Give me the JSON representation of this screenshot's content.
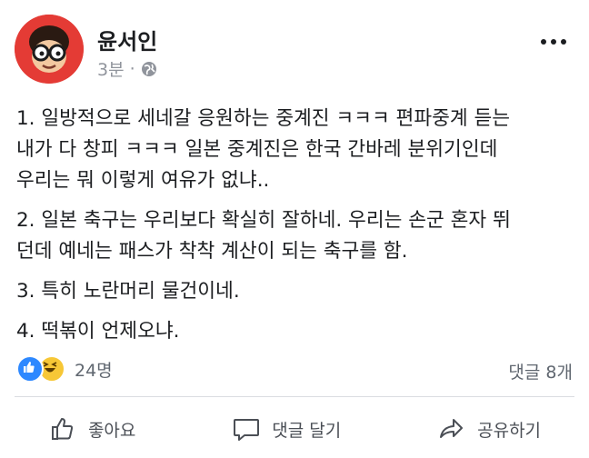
{
  "post": {
    "author": "윤서인",
    "time": "3분",
    "separator": "·",
    "privacy_icon": "globe-icon",
    "paragraphs": [
      [
        "1. 일방적으로 세네갈 응원하는 중계진 ㅋㅋㅋ 편파중계 듣는",
        "내가 다 창피 ㅋㅋㅋ 일본 중계진은 한국 간바레 분위기인데",
        "우리는 뭐 이렇게 여유가 없냐.."
      ],
      [
        "2. 일본 축구는 우리보다 확실히 잘하네. 우리는 손군 혼자 뛰",
        "던데 예네는 패스가 착착 계산이 되는 축구를 함."
      ],
      [
        "3. 특히 노란머리 물건이네."
      ],
      [
        "4. 떡볶이 언제오냐."
      ]
    ]
  },
  "reactions": {
    "icons": [
      "like-icon",
      "haha-icon"
    ],
    "count": "24명",
    "comments": "댓글 8개"
  },
  "actions": {
    "like": "좋아요",
    "comment": "댓글 달기",
    "share": "공유하기"
  },
  "colors": {
    "like_blue": "#2d88ff",
    "haha_yellow": "#f7c736",
    "avatar_red": "#e43b35",
    "meta_gray": "#90949c"
  }
}
